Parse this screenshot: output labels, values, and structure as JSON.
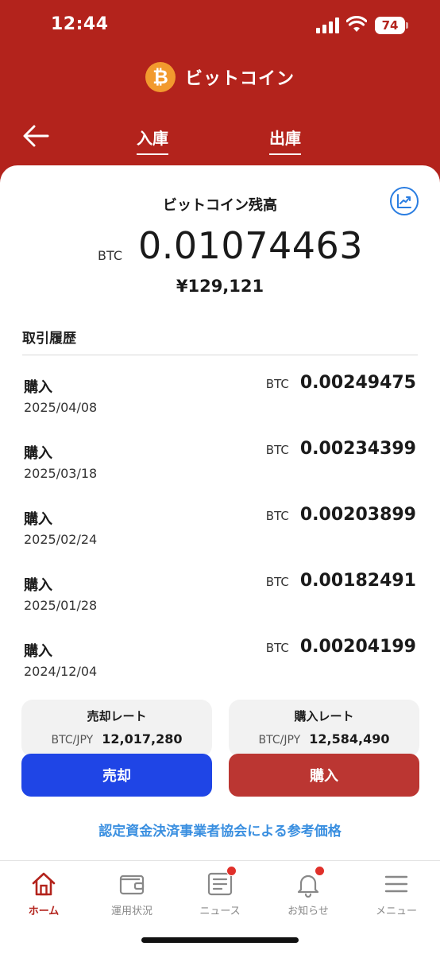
{
  "status_bar": {
    "time": "12:44",
    "battery": "74"
  },
  "header": {
    "coin_logo": "₿",
    "coin_name": "ビットコイン",
    "tabs": [
      {
        "label": "入庫"
      },
      {
        "label": "出庫"
      }
    ]
  },
  "balance": {
    "title": "ビットコイン残高",
    "unit": "BTC",
    "amount": "0.01074463",
    "jpy": "¥129,121"
  },
  "history": {
    "title": "取引履歴",
    "rows": [
      {
        "type": "購入",
        "date": "2025/04/08",
        "unit": "BTC",
        "amount": "0.00249475"
      },
      {
        "type": "購入",
        "date": "2025/03/18",
        "unit": "BTC",
        "amount": "0.00234399"
      },
      {
        "type": "購入",
        "date": "2025/02/24",
        "unit": "BTC",
        "amount": "0.00203899"
      },
      {
        "type": "購入",
        "date": "2025/01/28",
        "unit": "BTC",
        "amount": "0.00182491"
      },
      {
        "type": "購入",
        "date": "2024/12/04",
        "unit": "BTC",
        "amount": "0.00204199"
      }
    ]
  },
  "rates": {
    "sell": {
      "label": "売却レート",
      "pair": "BTC/JPY",
      "value": "12,017,280",
      "button": "売却"
    },
    "buy": {
      "label": "購入レート",
      "pair": "BTC/JPY",
      "value": "12,584,490",
      "button": "購入"
    }
  },
  "reference_link": "認定資金決済事業者協会による参考価格",
  "bottom_nav": [
    {
      "label": "ホーム",
      "icon": "home-icon",
      "active": true
    },
    {
      "label": "運用状況",
      "icon": "wallet-icon",
      "active": false
    },
    {
      "label": "ニュース",
      "icon": "news-icon",
      "active": false,
      "badge": true
    },
    {
      "label": "お知らせ",
      "icon": "bell-icon",
      "active": false,
      "badge": true
    },
    {
      "label": "メニュー",
      "icon": "menu-icon",
      "active": false
    }
  ],
  "colors": {
    "brand_red": "#b3231c",
    "sell_blue": "#1f45e6",
    "buy_red": "#bb3632",
    "link_blue": "#3a8fe0",
    "bitcoin_orange": "#f29a2e"
  }
}
